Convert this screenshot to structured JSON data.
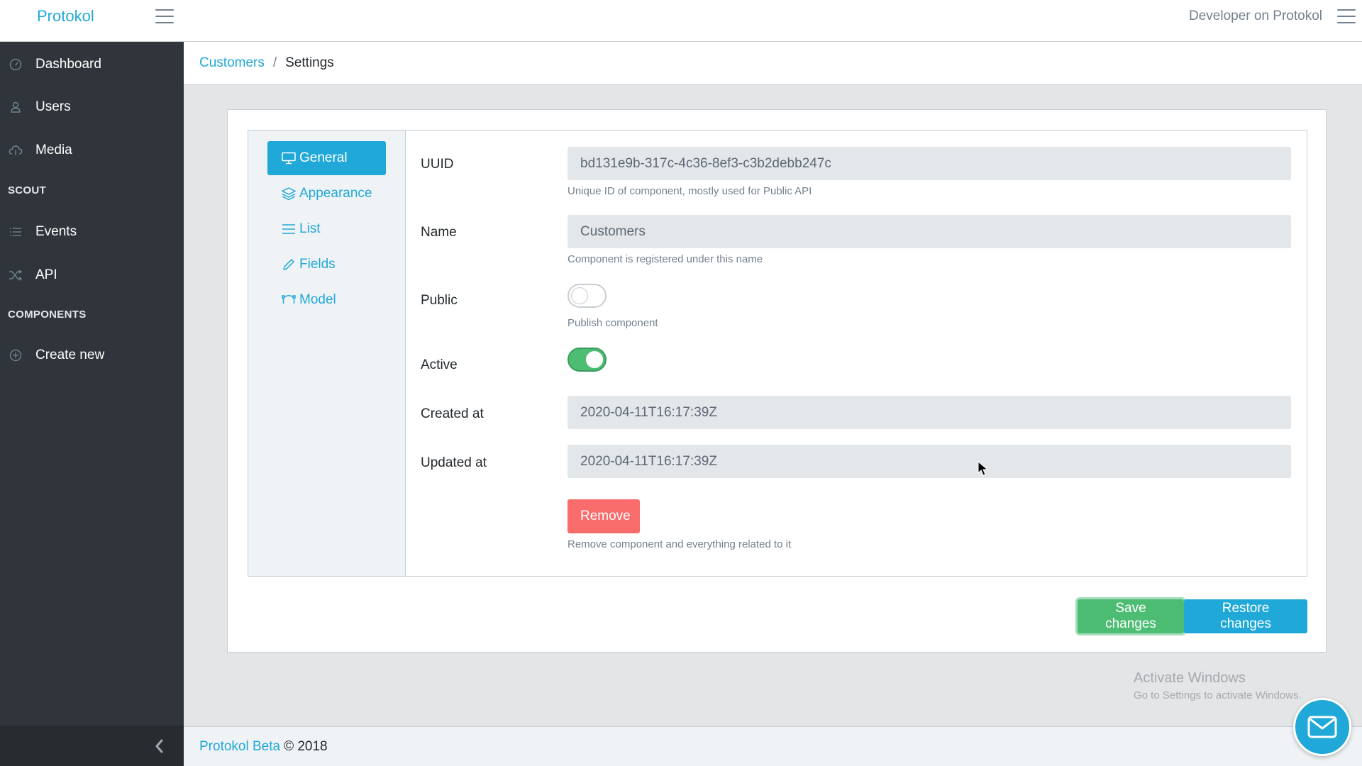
{
  "header": {
    "brand": "Protokol",
    "user": "Developer on Protokol"
  },
  "sidebar": {
    "items": [
      {
        "label": "Dashboard",
        "icon": "speedometer-icon"
      },
      {
        "label": "Users",
        "icon": "user-icon"
      },
      {
        "label": "Media",
        "icon": "cloud-upload-icon"
      }
    ],
    "section_scout": "SCOUT",
    "scout_items": [
      {
        "label": "Events",
        "icon": "list-icon"
      },
      {
        "label": "API",
        "icon": "shuffle-icon"
      }
    ],
    "section_components": "COMPONENTS",
    "component_items": [
      {
        "label": "Create new",
        "icon": "plus-circle-icon"
      }
    ]
  },
  "breadcrumb": {
    "parent": "Customers",
    "separator": "/",
    "current": "Settings"
  },
  "tabs": [
    {
      "label": "General",
      "icon": "monitor-icon",
      "active": true
    },
    {
      "label": "Appearance",
      "icon": "layers-icon",
      "active": false
    },
    {
      "label": "List",
      "icon": "list-icon",
      "active": false
    },
    {
      "label": "Fields",
      "icon": "pencil-icon",
      "active": false
    },
    {
      "label": "Model",
      "icon": "vector-icon",
      "active": false
    }
  ],
  "form": {
    "uuid": {
      "label": "UUID",
      "value": "bd131e9b-317c-4c36-8ef3-c3b2debb247c",
      "help": "Unique ID of component, mostly used for Public API"
    },
    "name": {
      "label": "Name",
      "value": "Customers",
      "help": "Component is registered under this name"
    },
    "public": {
      "label": "Public",
      "checked": false,
      "help": "Publish component"
    },
    "active": {
      "label": "Active",
      "checked": true
    },
    "created_at": {
      "label": "Created at",
      "value": "2020-04-11T16:17:39Z"
    },
    "updated_at": {
      "label": "Updated at",
      "value": "2020-04-11T16:17:39Z"
    },
    "remove": {
      "label": "Remove",
      "help": "Remove component and everything related to it"
    }
  },
  "actions": {
    "save": "Save changes",
    "restore": "Restore changes"
  },
  "footer": {
    "link": "Protokol Beta",
    "text": "© 2018"
  },
  "watermark": {
    "title": "Activate Windows",
    "subtitle": "Go to Settings to activate Windows."
  },
  "colors": {
    "primary": "#20a8d8",
    "success": "#4dbd74",
    "danger": "#f86c6b",
    "sidebar": "#2f353a"
  }
}
